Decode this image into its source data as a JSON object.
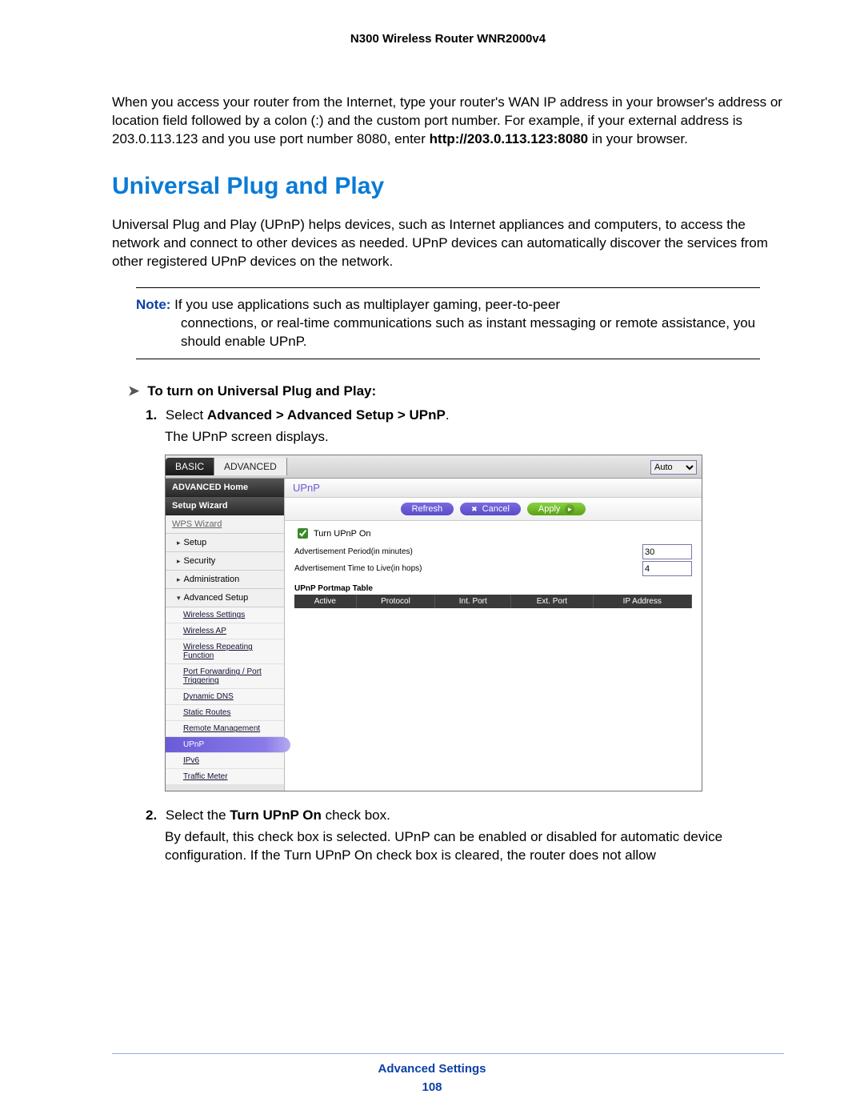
{
  "header": {
    "product": "N300 Wireless Router WNR2000v4"
  },
  "intro": {
    "text_before_bold": "When you access your router from the Internet, type your router's WAN IP address in your browser's address or location field followed by a colon (:) and the custom port number. For example, if your external address is 203.0.113.123 and you use port number 8080, enter ",
    "bold": "http://203.0.113.123:8080",
    "text_after_bold": " in your browser."
  },
  "section_title": "Universal Plug and Play",
  "upnp_intro": "Universal Plug and Play (UPnP) helps devices, such as Internet appliances and computers, to access the network and connect to other devices as needed. UPnP devices can automatically discover the services from other registered UPnP devices on the network.",
  "note": {
    "label": "Note:",
    "line1": " If you use applications such as multiplayer gaming, peer-to-peer",
    "line2": "connections, or real-time communications such as instant messaging or remote assistance, you should enable UPnP."
  },
  "task_heading": "To turn on Universal Plug and Play:",
  "steps": {
    "s1_num": "1.",
    "s1_a": "Select ",
    "s1_b": "Advanced > Advanced Setup > UPnP",
    "s1_c": ".",
    "s1_sub": "The UPnP screen displays.",
    "s2_num": "2.",
    "s2_a": "Select the ",
    "s2_b": "Turn UPnP On",
    "s2_c": " check box.",
    "s2_sub": "By default, this check box is selected. UPnP can be enabled or disabled for automatic device configuration. If the Turn UPnP On check box is cleared, the router does not allow"
  },
  "router": {
    "tabs": {
      "basic": "BASIC",
      "advanced": "ADVANCED"
    },
    "auto_option": "Auto",
    "sidebar": {
      "home": "ADVANCED Home",
      "wizard": "Setup Wizard",
      "wps": "WPS Wizard",
      "setup": "Setup",
      "security": "Security",
      "admin": "Administration",
      "adv_setup": "Advanced Setup",
      "subs": {
        "wireless_settings": "Wireless Settings",
        "wireless_ap": "Wireless AP",
        "wrf": "Wireless Repeating Function",
        "pf": "Port Forwarding / Port Triggering",
        "ddns": "Dynamic DNS",
        "static": "Static Routes",
        "remote": "Remote Management",
        "upnp": "UPnP",
        "ipv6": "IPv6",
        "traffic": "Traffic Meter"
      }
    },
    "content": {
      "title": "UPnP",
      "buttons": {
        "refresh": "Refresh",
        "cancel": "Cancel",
        "apply": "Apply"
      },
      "turn_on": "Turn UPnP On",
      "adv_period_label": "Advertisement Period(in minutes)",
      "adv_period_value": "30",
      "adv_ttl_label": "Advertisement Time to Live(in hops)",
      "adv_ttl_value": "4",
      "table_title": "UPnP Portmap Table",
      "columns": {
        "active": "Active",
        "protocol": "Protocol",
        "int": "Int. Port",
        "ext": "Ext. Port",
        "ip": "IP Address"
      }
    }
  },
  "footer": {
    "section": "Advanced Settings",
    "page": "108"
  }
}
